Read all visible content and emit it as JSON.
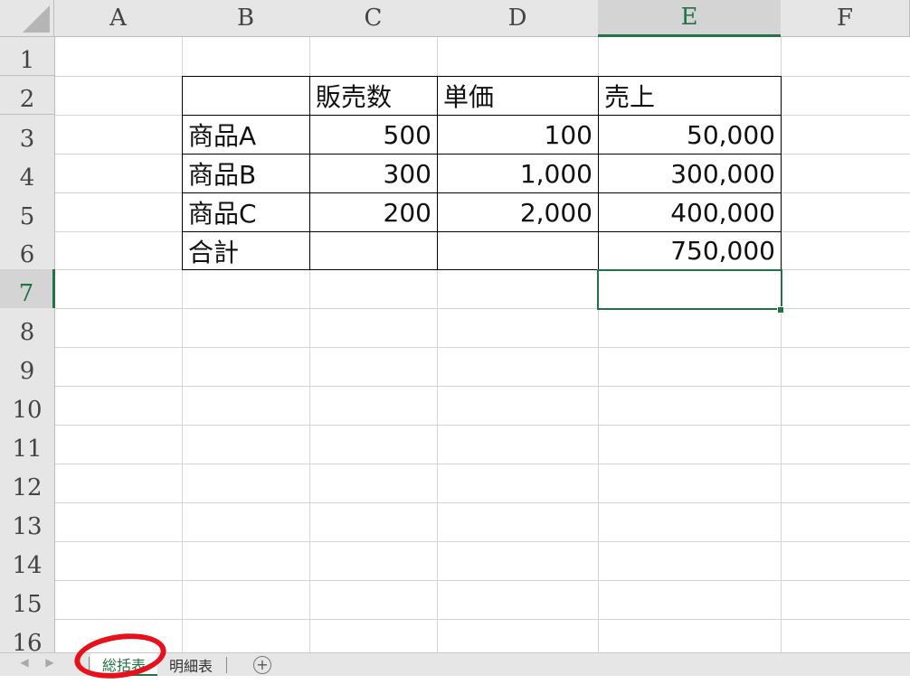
{
  "columns": [
    "A",
    "B",
    "C",
    "D",
    "E",
    "F"
  ],
  "rows": [
    "1",
    "2",
    "3",
    "4",
    "5",
    "6",
    "7",
    "8",
    "9",
    "10",
    "11",
    "12",
    "13",
    "14",
    "15",
    "16"
  ],
  "active_cell": {
    "column": "E",
    "row": "7"
  },
  "table": {
    "header": {
      "b": "",
      "c": "販売数",
      "d": "単価",
      "e": "売上"
    },
    "items": [
      {
        "b": "商品A",
        "c": "500",
        "d": "100",
        "e": "50,000"
      },
      {
        "b": "商品B",
        "c": "300",
        "d": "1,000",
        "e": "300,000"
      },
      {
        "b": "商品C",
        "c": "200",
        "d": "2,000",
        "e": "400,000"
      }
    ],
    "total": {
      "b": "合計",
      "c": "",
      "d": "",
      "e": "750,000"
    }
  },
  "sheet_tabs": [
    {
      "label": "総括表",
      "active": true
    },
    {
      "label": "明細表",
      "active": false
    }
  ],
  "add_sheet_label": "+",
  "colors": {
    "accent": "#217346",
    "annotation": "#e8101a"
  },
  "icons": {
    "scroll_left": "triangle-left-icon",
    "scroll_right": "triangle-right-icon",
    "add_sheet": "plus-circle-icon"
  }
}
